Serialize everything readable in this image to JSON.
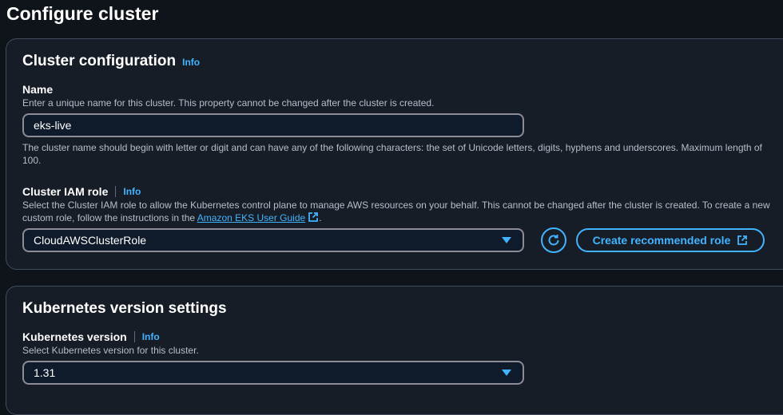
{
  "page": {
    "title": "Configure cluster"
  },
  "cluster_config": {
    "title": "Cluster configuration",
    "info": "Info",
    "name": {
      "label": "Name",
      "description": "Enter a unique name for this cluster. This property cannot be changed after the cluster is created.",
      "value": "eks-live",
      "constraint": "The cluster name should begin with letter or digit and can have any of the following characters: the set of Unicode letters, digits, hyphens and underscores. Maximum length of 100."
    },
    "iam_role": {
      "label": "Cluster IAM role",
      "info": "Info",
      "description_prefix": "Select the Cluster IAM role to allow the Kubernetes control plane to manage AWS resources on your behalf. This cannot be changed after the cluster is created. To create a new custom role, follow the instructions in the ",
      "link_text": "Amazon EKS User Guide",
      "description_suffix": ".",
      "selected": "CloudAWSClusterRole",
      "refresh_icon": "refresh-icon",
      "create_button": "Create recommended role",
      "external_icon": "external-link-icon"
    }
  },
  "k8s_settings": {
    "title": "Kubernetes version settings",
    "version": {
      "label": "Kubernetes version",
      "info": "Info",
      "description": "Select Kubernetes version for this cluster.",
      "selected": "1.31"
    }
  },
  "colors": {
    "background": "#0f141a",
    "panel": "#161d26",
    "border": "#414d5c",
    "accent": "#42b4ff",
    "muted_text": "#b6bec9"
  }
}
